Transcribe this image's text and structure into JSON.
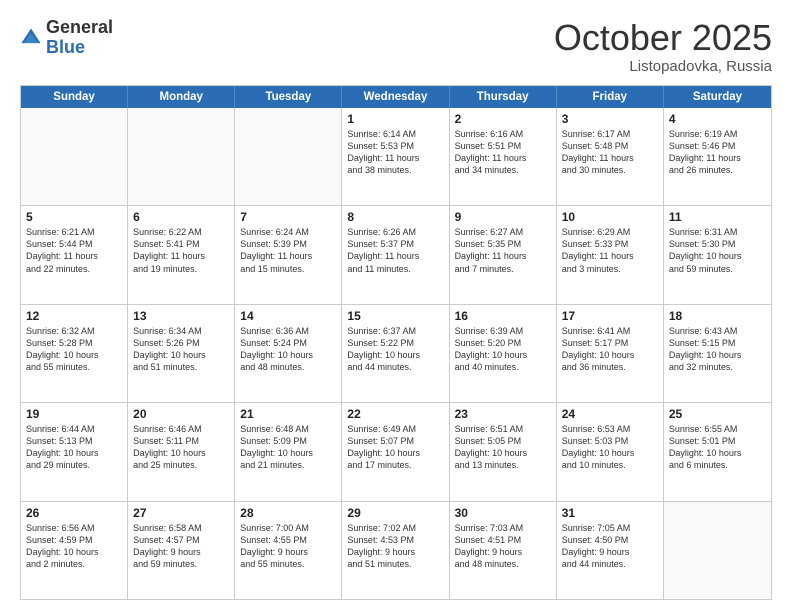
{
  "header": {
    "logo_general": "General",
    "logo_blue": "Blue",
    "month": "October 2025",
    "location": "Listopadovka, Russia"
  },
  "days_of_week": [
    "Sunday",
    "Monday",
    "Tuesday",
    "Wednesday",
    "Thursday",
    "Friday",
    "Saturday"
  ],
  "rows": [
    [
      {
        "day": "",
        "text": "",
        "empty": true
      },
      {
        "day": "",
        "text": "",
        "empty": true
      },
      {
        "day": "",
        "text": "",
        "empty": true
      },
      {
        "day": "1",
        "text": "Sunrise: 6:14 AM\nSunset: 5:53 PM\nDaylight: 11 hours\nand 38 minutes.",
        "empty": false
      },
      {
        "day": "2",
        "text": "Sunrise: 6:16 AM\nSunset: 5:51 PM\nDaylight: 11 hours\nand 34 minutes.",
        "empty": false
      },
      {
        "day": "3",
        "text": "Sunrise: 6:17 AM\nSunset: 5:48 PM\nDaylight: 11 hours\nand 30 minutes.",
        "empty": false
      },
      {
        "day": "4",
        "text": "Sunrise: 6:19 AM\nSunset: 5:46 PM\nDaylight: 11 hours\nand 26 minutes.",
        "empty": false
      }
    ],
    [
      {
        "day": "5",
        "text": "Sunrise: 6:21 AM\nSunset: 5:44 PM\nDaylight: 11 hours\nand 22 minutes.",
        "empty": false
      },
      {
        "day": "6",
        "text": "Sunrise: 6:22 AM\nSunset: 5:41 PM\nDaylight: 11 hours\nand 19 minutes.",
        "empty": false
      },
      {
        "day": "7",
        "text": "Sunrise: 6:24 AM\nSunset: 5:39 PM\nDaylight: 11 hours\nand 15 minutes.",
        "empty": false
      },
      {
        "day": "8",
        "text": "Sunrise: 6:26 AM\nSunset: 5:37 PM\nDaylight: 11 hours\nand 11 minutes.",
        "empty": false
      },
      {
        "day": "9",
        "text": "Sunrise: 6:27 AM\nSunset: 5:35 PM\nDaylight: 11 hours\nand 7 minutes.",
        "empty": false
      },
      {
        "day": "10",
        "text": "Sunrise: 6:29 AM\nSunset: 5:33 PM\nDaylight: 11 hours\nand 3 minutes.",
        "empty": false
      },
      {
        "day": "11",
        "text": "Sunrise: 6:31 AM\nSunset: 5:30 PM\nDaylight: 10 hours\nand 59 minutes.",
        "empty": false
      }
    ],
    [
      {
        "day": "12",
        "text": "Sunrise: 6:32 AM\nSunset: 5:28 PM\nDaylight: 10 hours\nand 55 minutes.",
        "empty": false
      },
      {
        "day": "13",
        "text": "Sunrise: 6:34 AM\nSunset: 5:26 PM\nDaylight: 10 hours\nand 51 minutes.",
        "empty": false
      },
      {
        "day": "14",
        "text": "Sunrise: 6:36 AM\nSunset: 5:24 PM\nDaylight: 10 hours\nand 48 minutes.",
        "empty": false
      },
      {
        "day": "15",
        "text": "Sunrise: 6:37 AM\nSunset: 5:22 PM\nDaylight: 10 hours\nand 44 minutes.",
        "empty": false
      },
      {
        "day": "16",
        "text": "Sunrise: 6:39 AM\nSunset: 5:20 PM\nDaylight: 10 hours\nand 40 minutes.",
        "empty": false
      },
      {
        "day": "17",
        "text": "Sunrise: 6:41 AM\nSunset: 5:17 PM\nDaylight: 10 hours\nand 36 minutes.",
        "empty": false
      },
      {
        "day": "18",
        "text": "Sunrise: 6:43 AM\nSunset: 5:15 PM\nDaylight: 10 hours\nand 32 minutes.",
        "empty": false
      }
    ],
    [
      {
        "day": "19",
        "text": "Sunrise: 6:44 AM\nSunset: 5:13 PM\nDaylight: 10 hours\nand 29 minutes.",
        "empty": false
      },
      {
        "day": "20",
        "text": "Sunrise: 6:46 AM\nSunset: 5:11 PM\nDaylight: 10 hours\nand 25 minutes.",
        "empty": false
      },
      {
        "day": "21",
        "text": "Sunrise: 6:48 AM\nSunset: 5:09 PM\nDaylight: 10 hours\nand 21 minutes.",
        "empty": false
      },
      {
        "day": "22",
        "text": "Sunrise: 6:49 AM\nSunset: 5:07 PM\nDaylight: 10 hours\nand 17 minutes.",
        "empty": false
      },
      {
        "day": "23",
        "text": "Sunrise: 6:51 AM\nSunset: 5:05 PM\nDaylight: 10 hours\nand 13 minutes.",
        "empty": false
      },
      {
        "day": "24",
        "text": "Sunrise: 6:53 AM\nSunset: 5:03 PM\nDaylight: 10 hours\nand 10 minutes.",
        "empty": false
      },
      {
        "day": "25",
        "text": "Sunrise: 6:55 AM\nSunset: 5:01 PM\nDaylight: 10 hours\nand 6 minutes.",
        "empty": false
      }
    ],
    [
      {
        "day": "26",
        "text": "Sunrise: 6:56 AM\nSunset: 4:59 PM\nDaylight: 10 hours\nand 2 minutes.",
        "empty": false
      },
      {
        "day": "27",
        "text": "Sunrise: 6:58 AM\nSunset: 4:57 PM\nDaylight: 9 hours\nand 59 minutes.",
        "empty": false
      },
      {
        "day": "28",
        "text": "Sunrise: 7:00 AM\nSunset: 4:55 PM\nDaylight: 9 hours\nand 55 minutes.",
        "empty": false
      },
      {
        "day": "29",
        "text": "Sunrise: 7:02 AM\nSunset: 4:53 PM\nDaylight: 9 hours\nand 51 minutes.",
        "empty": false
      },
      {
        "day": "30",
        "text": "Sunrise: 7:03 AM\nSunset: 4:51 PM\nDaylight: 9 hours\nand 48 minutes.",
        "empty": false
      },
      {
        "day": "31",
        "text": "Sunrise: 7:05 AM\nSunset: 4:50 PM\nDaylight: 9 hours\nand 44 minutes.",
        "empty": false
      },
      {
        "day": "",
        "text": "",
        "empty": true
      }
    ]
  ]
}
